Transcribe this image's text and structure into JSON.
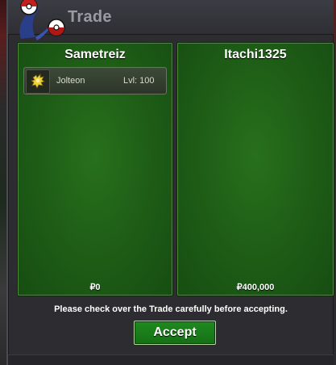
{
  "window": {
    "title": "Trade"
  },
  "trade": {
    "left": {
      "player_name": "Sametreiz",
      "money": "₽0",
      "items": [
        {
          "name": "Jolteon",
          "level": "Lvl: 100",
          "icon": "jolteon-icon"
        }
      ]
    },
    "right": {
      "player_name": "Itachi1325",
      "money": "₽400,000",
      "items": []
    }
  },
  "footer": {
    "notice": "Please check over the Trade carefully before accepting.",
    "accept_label": "Accept"
  },
  "colors": {
    "panel_green": "#1f5f17",
    "accept_green": "#1f8a1f",
    "title_gray": "#9a9aa2"
  }
}
